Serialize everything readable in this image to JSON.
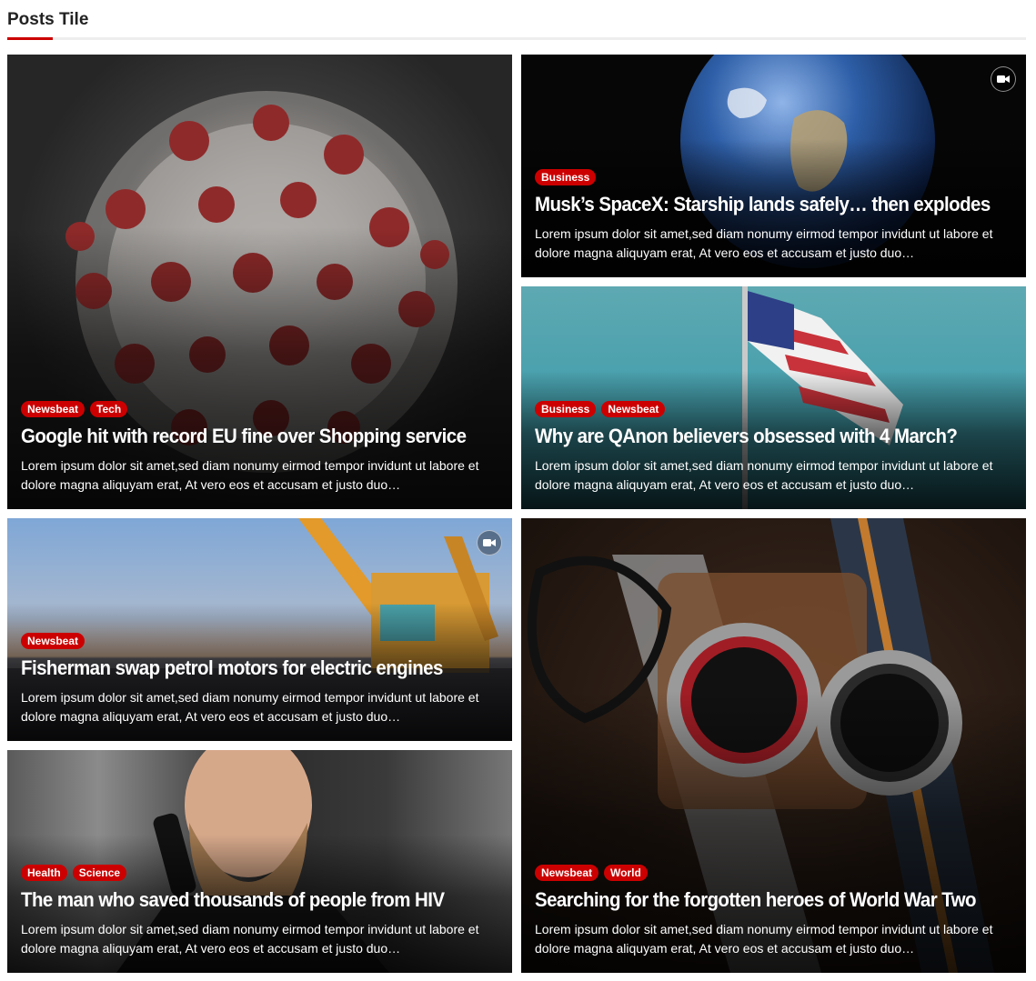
{
  "section": {
    "title": "Posts Tile"
  },
  "posts": [
    {
      "categories": [
        "Newsbeat",
        "Tech"
      ],
      "title": "Google hit with record EU fine over Shopping service",
      "excerpt": "Lorem ipsum dolor sit amet,sed diam nonumy eirmod tempor invidunt ut labore et dolore magna aliquyam erat, At vero eos et accusam et justo duo…"
    },
    {
      "categories": [
        "Business"
      ],
      "title": "Musk’s SpaceX: Starship lands safely… then explodes",
      "excerpt": "Lorem ipsum dolor sit amet,sed diam nonumy eirmod tempor invidunt ut labore et dolore magna aliquyam erat, At vero eos et accusam et justo duo…"
    },
    {
      "categories": [
        "Business",
        "Newsbeat"
      ],
      "title": "Why are QAnon believers obsessed with 4 March?",
      "excerpt": "Lorem ipsum dolor sit amet,sed diam nonumy eirmod tempor invidunt ut labore et dolore magna aliquyam erat, At vero eos et accusam et justo duo…"
    },
    {
      "categories": [
        "Newsbeat"
      ],
      "title": "Fisherman swap petrol motors for electric engines",
      "excerpt": "Lorem ipsum dolor sit amet,sed diam nonumy eirmod tempor invidunt ut labore et dolore magna aliquyam erat, At vero eos et accusam et justo duo…"
    },
    {
      "categories": [
        "Health",
        "Science"
      ],
      "title": "The man who saved thousands of people from HIV",
      "excerpt": "Lorem ipsum dolor sit amet,sed diam nonumy eirmod tempor invidunt ut labore et dolore magna aliquyam erat, At vero eos et accusam et justo duo…"
    },
    {
      "categories": [
        "Newsbeat",
        "World"
      ],
      "title": "Searching for the forgotten heroes of World War Two",
      "excerpt": "Lorem ipsum dolor sit amet,sed diam nonumy eirmod tempor invidunt ut labore et dolore magna aliquyam erat, At vero eos et accusam et justo duo…"
    }
  ],
  "icons": {
    "video": "video-camera-icon"
  },
  "colors": {
    "accent": "#cc0000"
  }
}
